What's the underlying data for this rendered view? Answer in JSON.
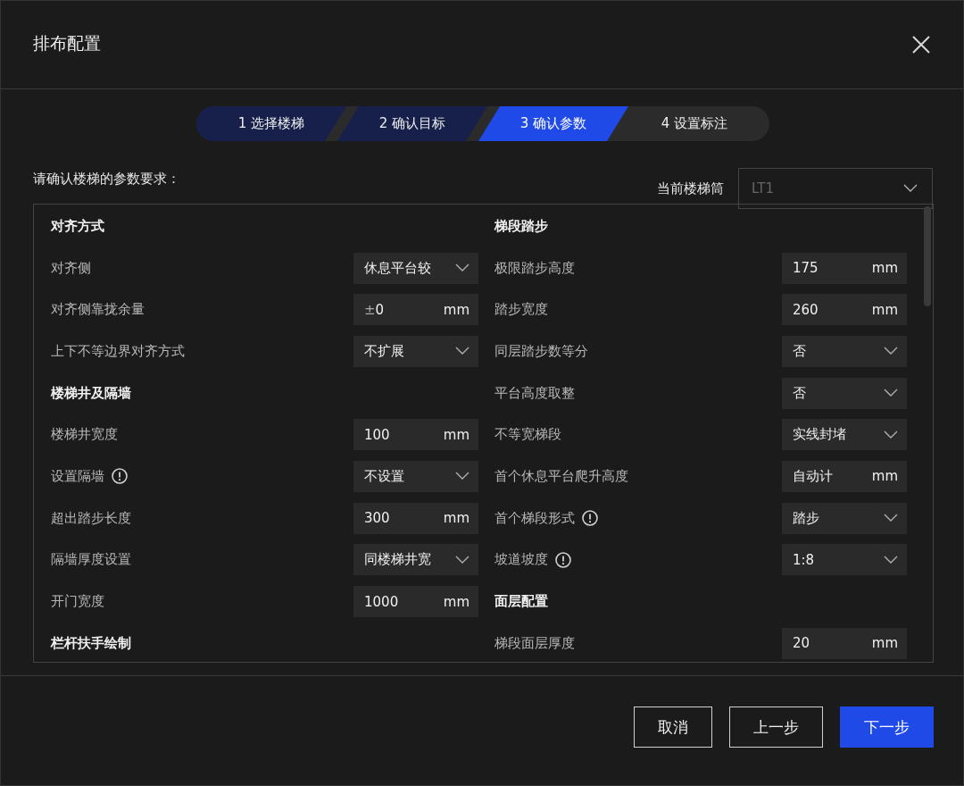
{
  "window": {
    "title": "排布配置"
  },
  "steps": [
    {
      "number": "1",
      "label": "选择楼梯",
      "selected": false,
      "completed": true
    },
    {
      "number": "2",
      "label": "确认目标",
      "selected": false,
      "completed": true
    },
    {
      "number": "3",
      "label": "确认参数",
      "selected": true,
      "completed": false
    },
    {
      "number": "4",
      "label": "设置标注",
      "selected": false,
      "completed": false
    }
  ],
  "prompt": "请确认楼梯的参数要求：",
  "current_stair": {
    "label": "当前楼梯筒",
    "value": "LT1",
    "disabled": true
  },
  "columns": [
    [
      {
        "kind": "heading",
        "label": "对齐方式"
      },
      {
        "kind": "select",
        "label": "对齐侧",
        "value": "休息平台较"
      },
      {
        "kind": "input",
        "label": "对齐侧靠拢余量",
        "prefix": "±",
        "value": "0",
        "unit": "mm"
      },
      {
        "kind": "select",
        "label": "上下不等边界对齐方式",
        "value": "不扩展"
      },
      {
        "kind": "heading",
        "label": "楼梯井及隔墙"
      },
      {
        "kind": "input",
        "label": "楼梯井宽度",
        "value": "100",
        "unit": "mm"
      },
      {
        "kind": "select",
        "label": "设置隔墙",
        "value": "不设置",
        "info": true
      },
      {
        "kind": "input",
        "label": "超出踏步长度",
        "value": "300",
        "unit": "mm"
      },
      {
        "kind": "select",
        "label": "隔墙厚度设置",
        "value": "同楼梯井宽"
      },
      {
        "kind": "input",
        "label": "开门宽度",
        "value": "1000",
        "unit": "mm"
      },
      {
        "kind": "heading",
        "label": "栏杆扶手绘制"
      }
    ],
    [
      {
        "kind": "heading",
        "label": "梯段踏步"
      },
      {
        "kind": "input",
        "label": "极限踏步高度",
        "value": "175",
        "unit": "mm"
      },
      {
        "kind": "input",
        "label": "踏步宽度",
        "value": "260",
        "unit": "mm"
      },
      {
        "kind": "select",
        "label": "同层踏步数等分",
        "value": "否"
      },
      {
        "kind": "select",
        "label": "平台高度取整",
        "value": "否"
      },
      {
        "kind": "select",
        "label": "不等宽梯段",
        "value": "实线封堵"
      },
      {
        "kind": "input",
        "label": "首个休息平台爬升高度",
        "value": "自动计",
        "unit": "mm"
      },
      {
        "kind": "select",
        "label": "首个梯段形式",
        "value": "踏步",
        "info": true
      },
      {
        "kind": "select",
        "label": "坡道坡度",
        "value": "1:8",
        "info": true
      },
      {
        "kind": "heading",
        "label": "面层配置"
      },
      {
        "kind": "input",
        "label": "梯段面层厚度",
        "value": "20",
        "unit": "mm"
      }
    ]
  ],
  "buttons": [
    {
      "label": "取消",
      "primary": false
    },
    {
      "label": "上一步",
      "primary": false
    },
    {
      "label": "下一步",
      "primary": true
    }
  ]
}
